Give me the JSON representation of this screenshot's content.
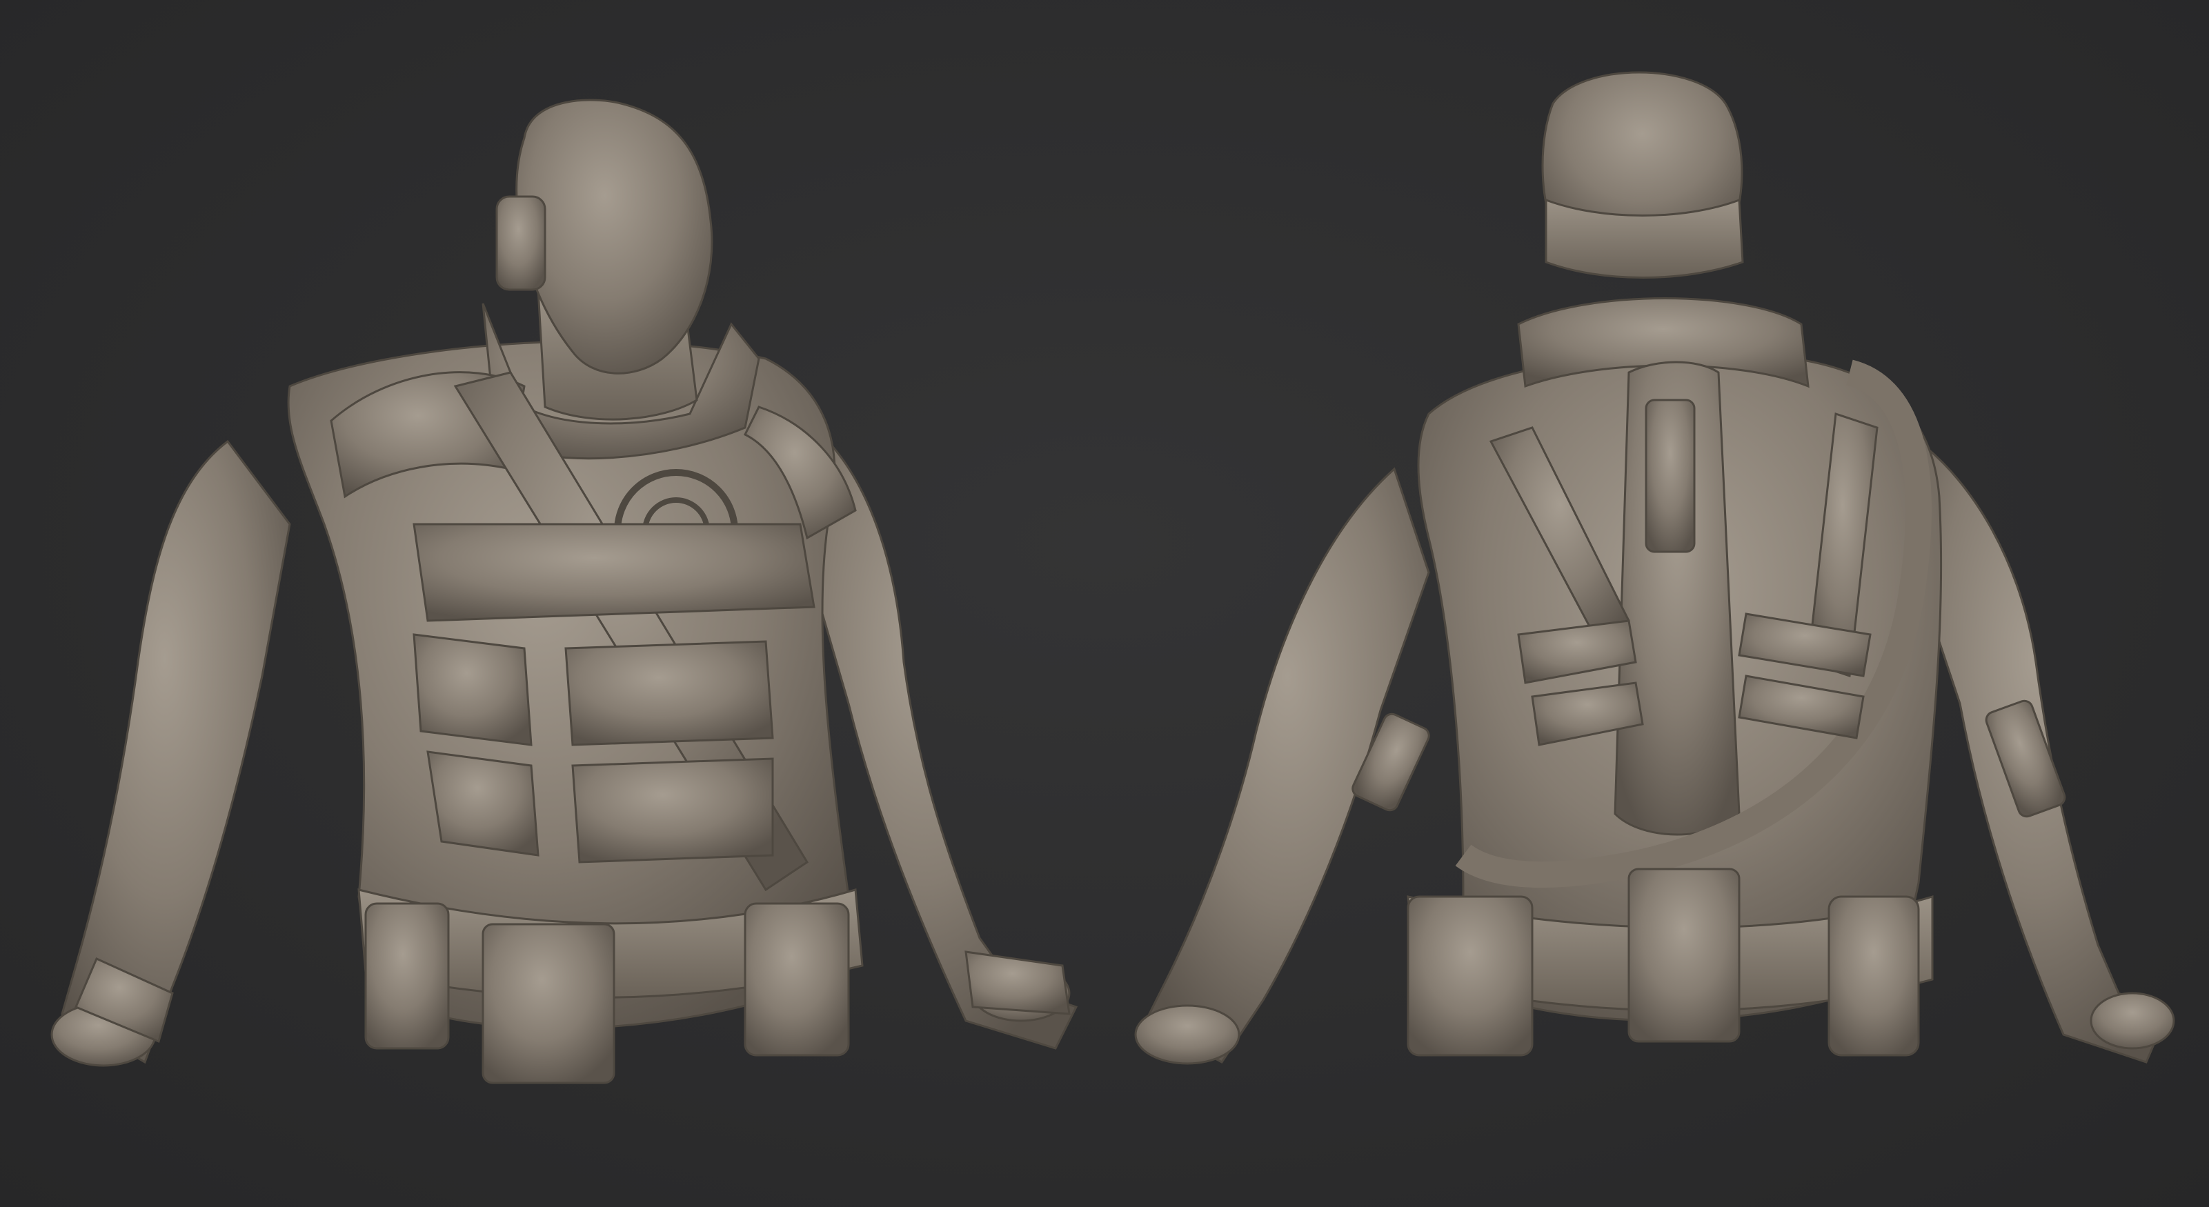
{
  "scene": {
    "background_color": "#2c2c2d",
    "clay_color": "#8a8176",
    "clay_highlight": "#a59c90",
    "clay_shadow": "#5a534b",
    "views": [
      {
        "id": "front-three-quarter",
        "icon": "clay-bust-front"
      },
      {
        "id": "back-three-quarter",
        "icon": "clay-bust-back"
      }
    ]
  }
}
